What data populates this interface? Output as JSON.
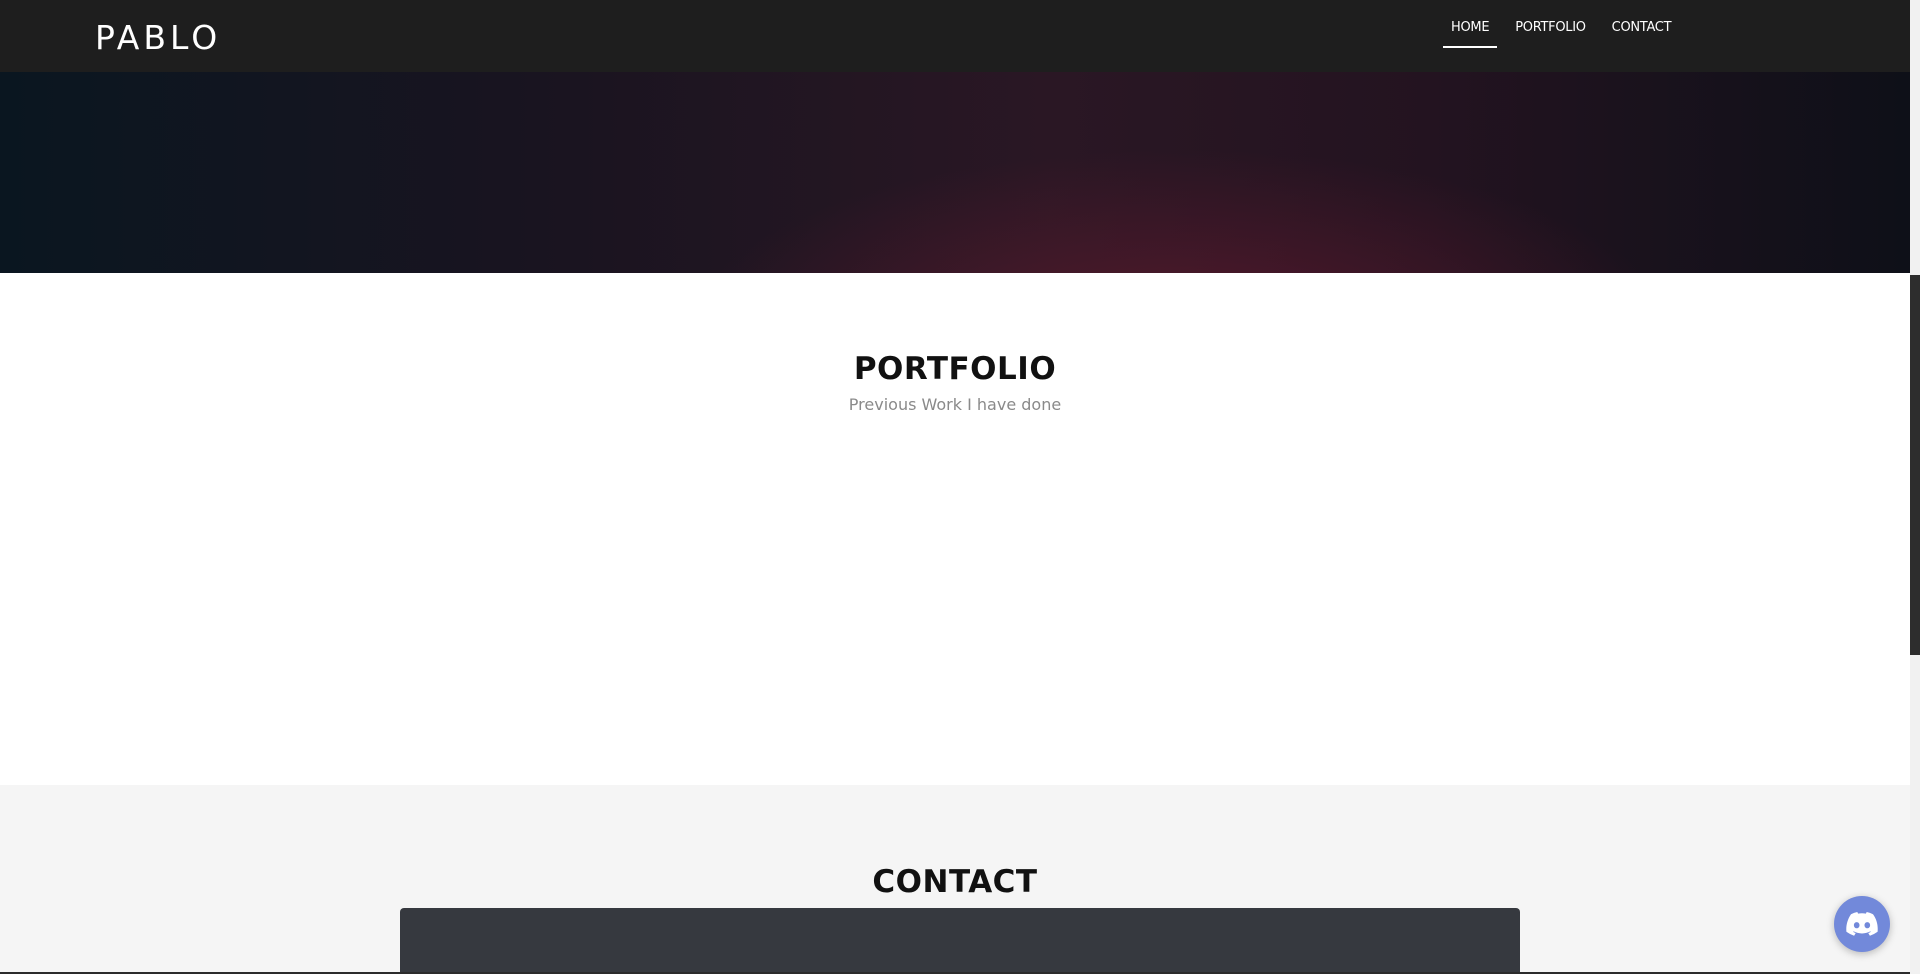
{
  "header": {
    "brand": "PABLO",
    "nav": [
      {
        "label": "HOME",
        "active": true
      },
      {
        "label": "PORTFOLIO",
        "active": false
      },
      {
        "label": "CONTACT",
        "active": false
      }
    ]
  },
  "portfolio": {
    "title": "PORTFOLIO",
    "subtitle": "Previous Work I have done"
  },
  "contact": {
    "title": "CONTACT"
  },
  "widgets": {
    "discord_icon": "discord-icon",
    "discord_color": "#7289da"
  },
  "colors": {
    "navbar": "#1e1e1e",
    "text_dark": "#111111",
    "subtitle": "#8a8a8a",
    "contact_bg": "#f5f5f5",
    "panel": "#36393f"
  }
}
